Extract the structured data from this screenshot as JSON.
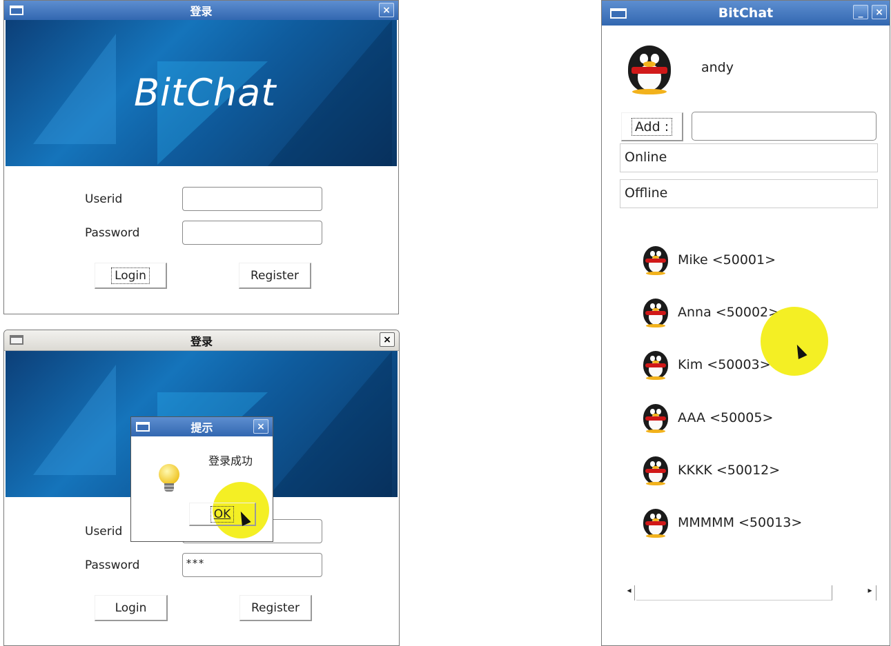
{
  "login_window": {
    "title": "登录",
    "banner_text": "BitChat",
    "userid_label": "Userid",
    "password_label": "Password",
    "userid_value": "",
    "password_value": "",
    "login_label": "Login",
    "register_label": "Register"
  },
  "login_window_2": {
    "title": "登录",
    "userid_label": "Userid",
    "password_label": "Password",
    "password_value": "***",
    "login_label": "Login",
    "register_label": "Register"
  },
  "dialog": {
    "title": "提示",
    "message": "登录成功",
    "ok_label": "OK"
  },
  "chat_window": {
    "title": "BitChat",
    "username": "andy",
    "add_label": "Add :",
    "add_value": "",
    "online_label": "Online",
    "offline_label": "Offline",
    "contacts": [
      "Mike <50001>",
      "Anna <50002>",
      "Kim <50003>",
      "AAA <50005>",
      "KKKK <50012>",
      "MMMMM <50013>"
    ]
  },
  "icons": {
    "close": "×",
    "minimize": "_",
    "scroll_left": "◂",
    "scroll_right": "▸"
  }
}
